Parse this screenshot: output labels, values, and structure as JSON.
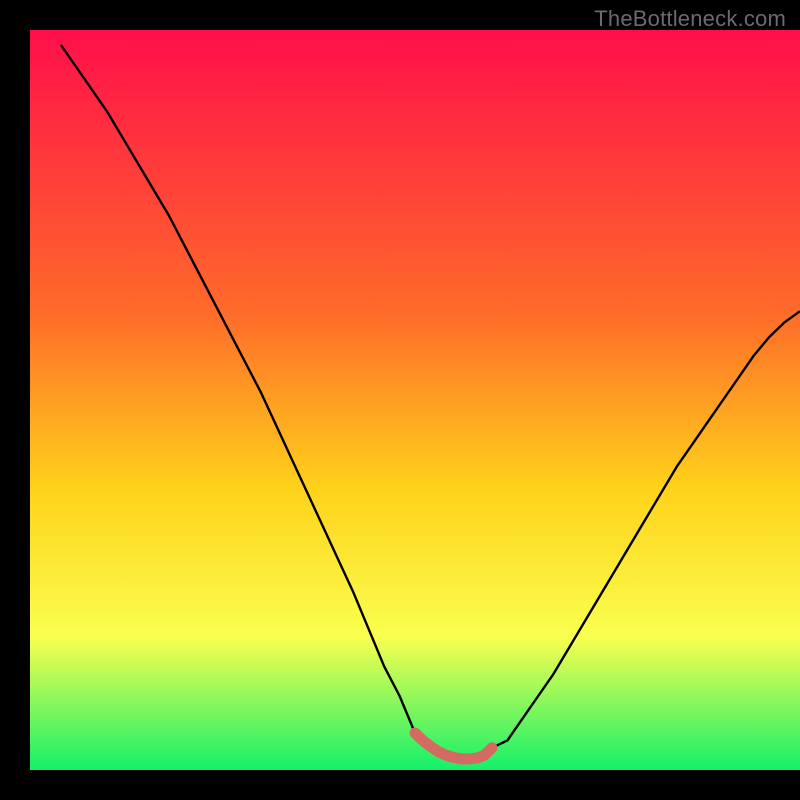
{
  "watermark": "TheBottleneck.com",
  "colors": {
    "black": "#000000",
    "curve": "#000000",
    "segment": "#d46a62",
    "grad_top": "#ff0f4a",
    "grad_mid1": "#ff6a2a",
    "grad_mid2": "#ffd21a",
    "grad_mid3": "#faff4f",
    "grad_bottom": "#14f06a"
  },
  "chart_data": {
    "type": "line",
    "title": "",
    "xlabel": "",
    "ylabel": "",
    "xlim": [
      0,
      100
    ],
    "ylim": [
      0,
      100
    ],
    "x": [
      4,
      6,
      8,
      10,
      12,
      14,
      16,
      18,
      20,
      22,
      24,
      26,
      28,
      30,
      32,
      34,
      36,
      38,
      40,
      42,
      44,
      46,
      48,
      50,
      51,
      52,
      53,
      54,
      55,
      56,
      57,
      58,
      59,
      60,
      62,
      64,
      66,
      68,
      70,
      72,
      74,
      76,
      78,
      80,
      82,
      84,
      86,
      88,
      90,
      92,
      94,
      96,
      98,
      100
    ],
    "y": [
      98,
      95,
      92,
      89,
      85.5,
      82,
      78.5,
      75,
      71,
      67,
      63,
      59,
      55,
      51,
      46.5,
      42,
      37.5,
      33,
      28.5,
      24,
      19,
      14,
      10,
      5,
      4,
      3.2,
      2.5,
      2,
      1.7,
      1.5,
      1.5,
      1.6,
      2,
      3,
      4,
      7,
      10,
      13,
      16.5,
      20,
      23.5,
      27,
      30.5,
      34,
      37.5,
      41,
      44,
      47,
      50,
      53,
      56,
      58.5,
      60.5,
      62
    ],
    "minimum_band": {
      "x_start": 50,
      "x_end": 60,
      "y": 2
    },
    "annotations": []
  }
}
